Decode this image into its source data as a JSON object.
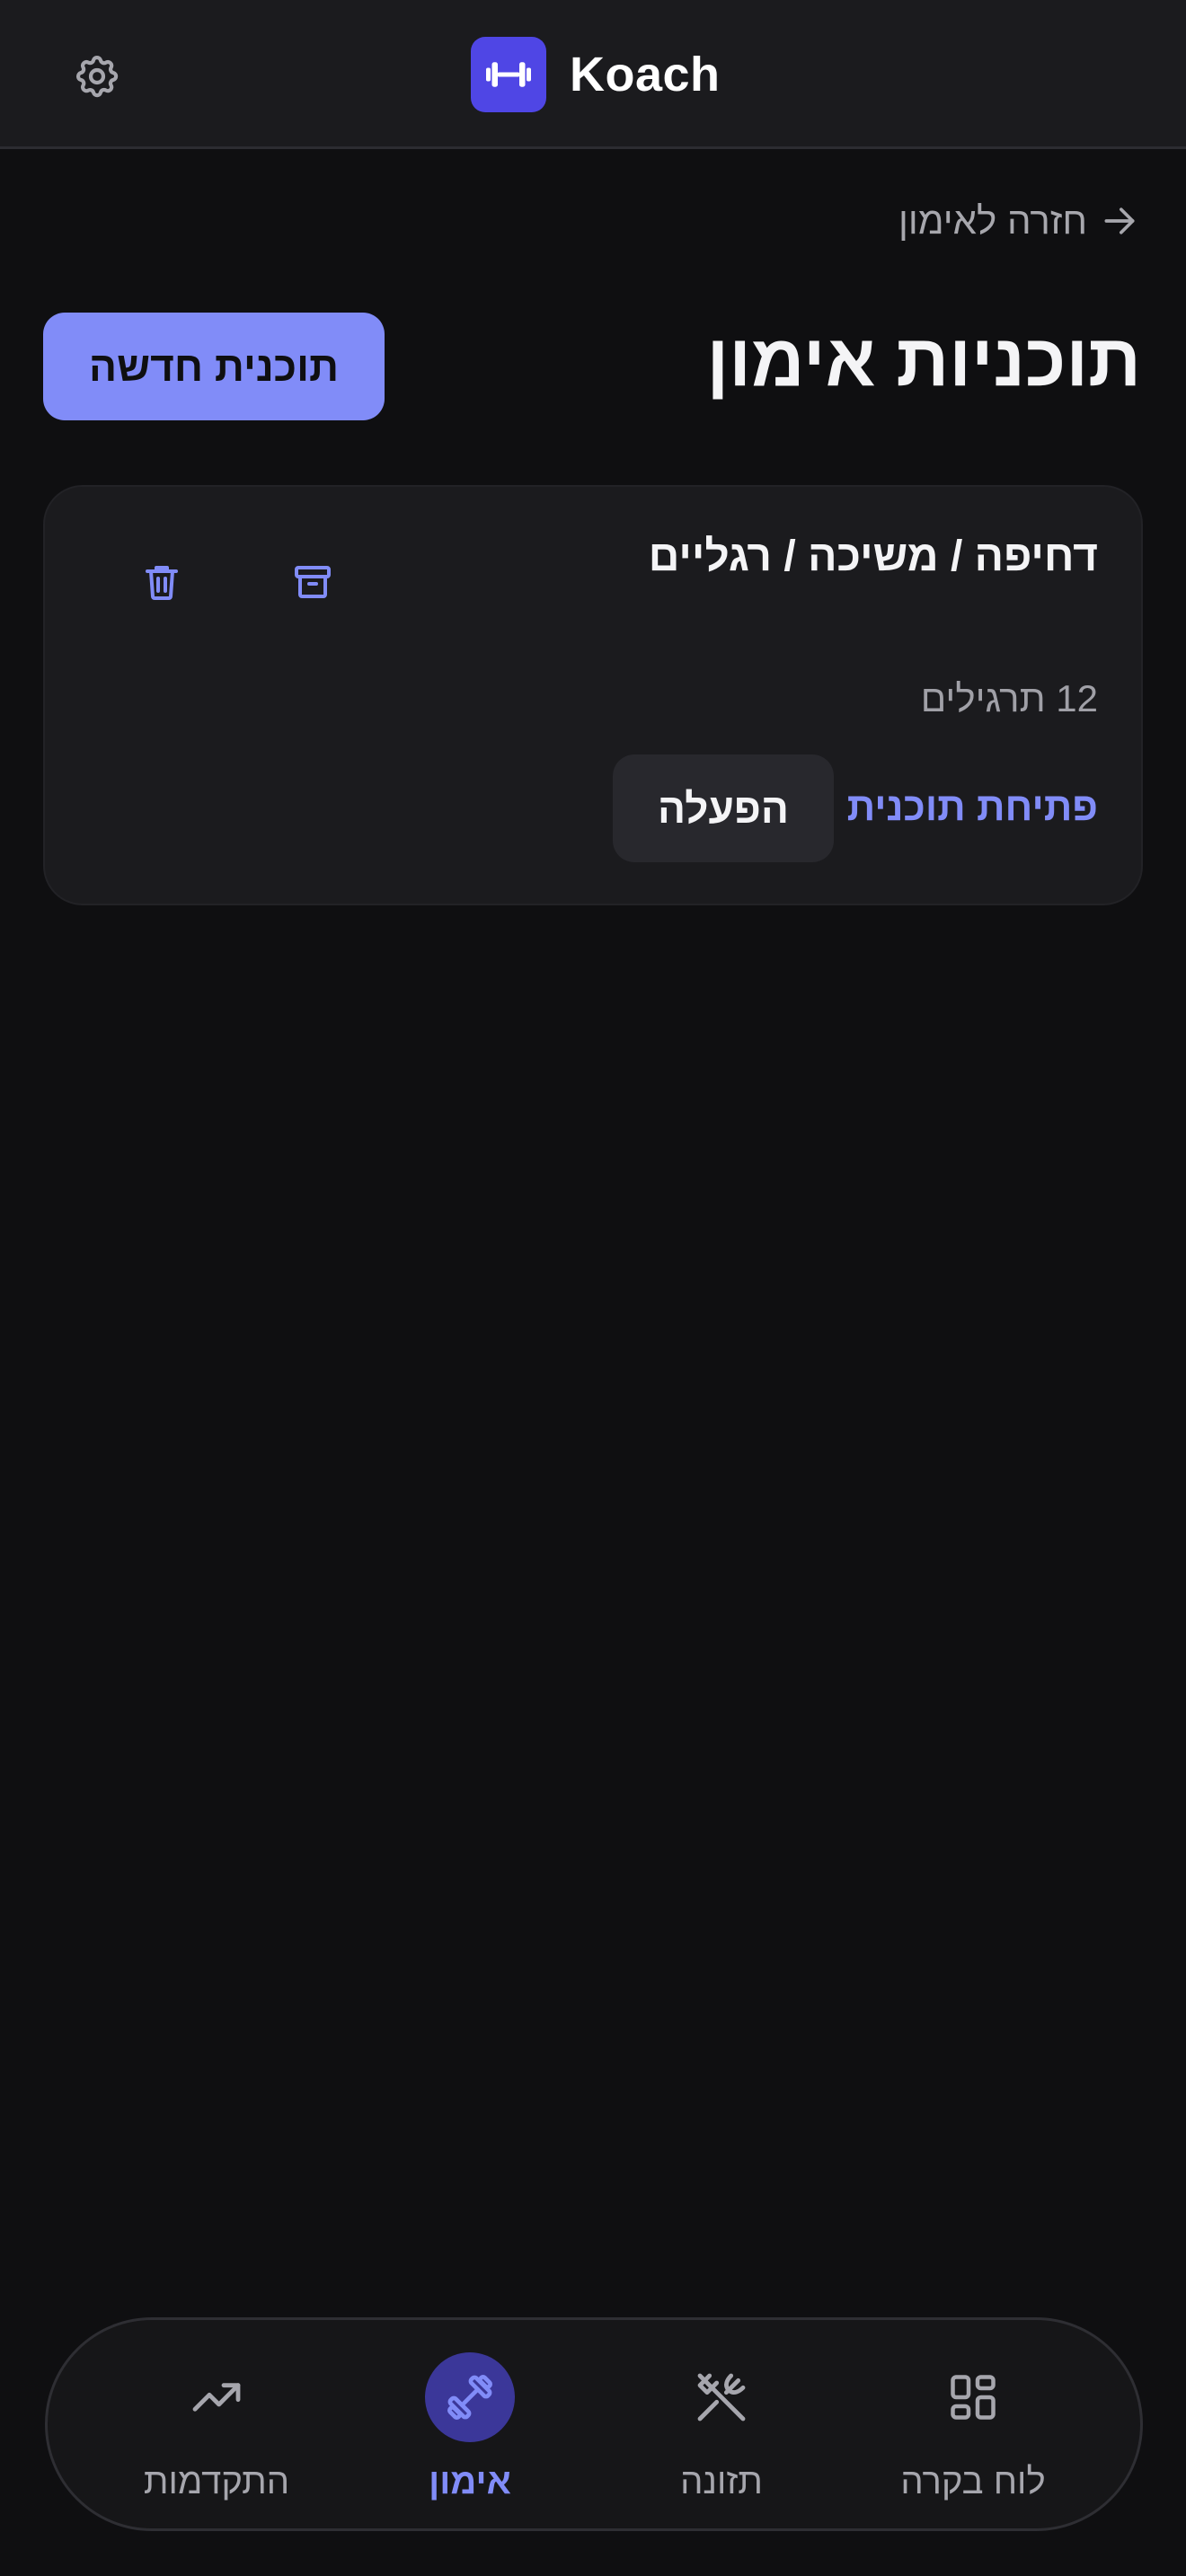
{
  "header": {
    "brand_name": "Koach",
    "settings_icon": "gear-icon",
    "logo_icon": "dumbbell-icon"
  },
  "back_link": {
    "label": "חזרה לאימון",
    "icon": "arrow-right-icon"
  },
  "page": {
    "title": "תוכניות אימון",
    "new_plan_label": "תוכנית חדשה"
  },
  "plans": [
    {
      "name": "דחיפה / משיכה / רגליים",
      "meta": "12 תרגילים",
      "open_label": "פתיחת תוכנית",
      "activate_label": "הפעלה",
      "archive_icon": "archive-icon",
      "delete_icon": "trash-icon"
    }
  ],
  "nav": {
    "items": [
      {
        "label": "לוח בקרה",
        "icon": "dashboard-grid-icon",
        "active": false
      },
      {
        "label": "תזונה",
        "icon": "utensils-icon",
        "active": false
      },
      {
        "label": "אימון",
        "icon": "dumbbell-icon",
        "active": true
      },
      {
        "label": "התקדמות",
        "icon": "trending-up-icon",
        "active": false
      }
    ]
  },
  "colors": {
    "background": "#0f0f11",
    "surface": "#1b1b1e",
    "accent": "#818cf8",
    "brand": "#4f46e5",
    "muted_text": "#a6a6ad"
  }
}
